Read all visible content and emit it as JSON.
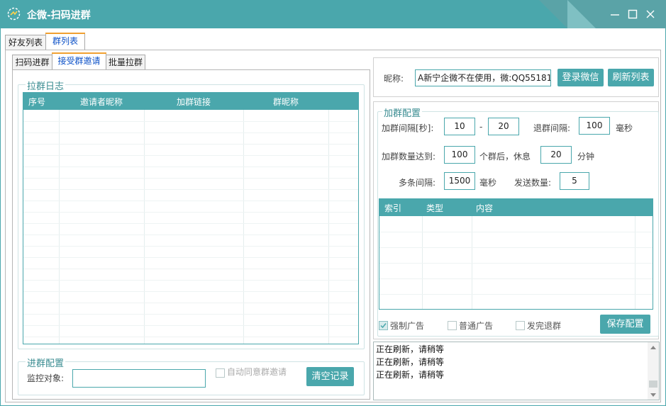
{
  "window": {
    "title": "企微-扫码进群",
    "accent": "#4aa7ac"
  },
  "top_tabs": [
    {
      "label": "好友列表",
      "active": false
    },
    {
      "label": "群列表",
      "active": true
    }
  ],
  "sub_tabs": [
    {
      "label": "扫码进群",
      "active": false
    },
    {
      "label": "接受群邀请",
      "active": true
    },
    {
      "label": "批量拉群",
      "active": false
    }
  ],
  "left": {
    "log_group": {
      "title": "拉群日志",
      "columns": [
        "序号",
        "邀请者昵称",
        "加群链接",
        "群昵称"
      ]
    },
    "config_group": {
      "title": "进群配置",
      "monitor_label": "监控对象:",
      "monitor_value": "",
      "auto_accept_label": "自动同意群邀请",
      "auto_accept_checked": false,
      "clear_button": "清空记录"
    }
  },
  "right": {
    "nickname_label": "昵称:",
    "nickname_value": "A新宁企微不在使用，微:QQ55181",
    "login_button": "登录微信",
    "refresh_button": "刷新列表",
    "config": {
      "title": "加群配置",
      "interval_label": "加群间隔[秒]:",
      "interval_min": "10",
      "interval_sep": "-",
      "interval_max": "20",
      "quit_interval_label": "退群间隔:",
      "quit_interval_value": "100",
      "ms_unit": "毫秒",
      "count_label": "加群数量达到:",
      "count_value": "100",
      "rest_label": "个群后，休息",
      "rest_value": "20",
      "minute_unit": "分钟",
      "multi_interval_label": "多条间隔:",
      "multi_interval_value": "1500",
      "send_count_label": "发送数量:",
      "send_count_value": "5",
      "columns": [
        "索引",
        "类型",
        "内容"
      ],
      "force_ad_label": "强制广告",
      "force_ad_checked": true,
      "normal_ad_label": "普通广告",
      "normal_ad_checked": false,
      "quit_after_label": "发完退群",
      "quit_after_checked": false,
      "save_button": "保存配置"
    },
    "log_lines": [
      "正在刷新，请稍等",
      "正在刷新，请稍等",
      "正在刷新，请稍等"
    ]
  }
}
